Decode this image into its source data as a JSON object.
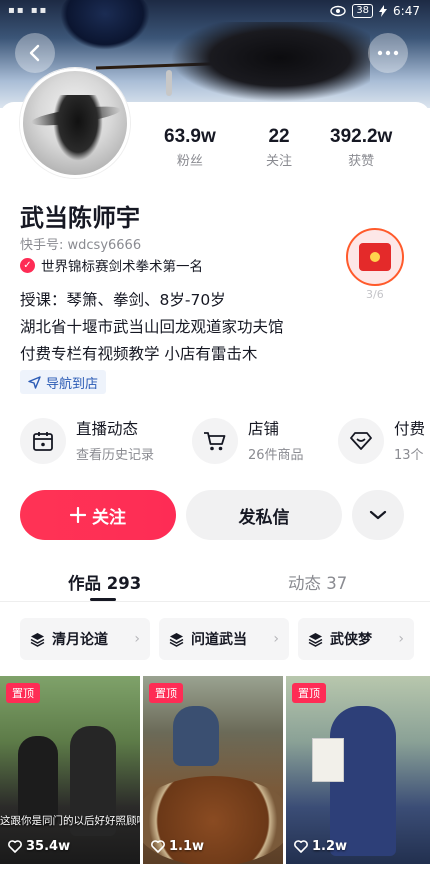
{
  "status_bar": {
    "left_icons": "▪▪ ▪▪",
    "battery": "38",
    "time": "6:47"
  },
  "profile": {
    "name": "武当陈师宇",
    "kuaishou_id": "快手号: wdcsy6666",
    "title_badge": "世界锦标赛剑术拳术第一名",
    "bio_lines": [
      "授课：琴箫、拳剑、8岁-70岁",
      "湖北省十堰市武当山回龙观道家功夫馆",
      "付费专栏有视频教学 小店有雷击木"
    ],
    "navigate_label": "导航到店",
    "gift_count": "3/6"
  },
  "stats": [
    {
      "value": "63.9w",
      "label": "粉丝"
    },
    {
      "value": "22",
      "label": "关注"
    },
    {
      "value": "392.2w",
      "label": "获赞"
    }
  ],
  "services": [
    {
      "title": "直播动态",
      "subtitle": "查看历史记录",
      "icon": "calendar-icon"
    },
    {
      "title": "店铺",
      "subtitle": "26件商品",
      "icon": "cart-icon"
    },
    {
      "title": "付费",
      "subtitle": "13个",
      "icon": "diamond-icon"
    }
  ],
  "actions": {
    "follow": "关注",
    "message": "发私信"
  },
  "tabs": {
    "works": "作品 293",
    "moments": "动态 37"
  },
  "collections": [
    {
      "label": "清月论道"
    },
    {
      "label": "问道武当"
    },
    {
      "label": "武侠梦"
    }
  ],
  "videos": [
    {
      "pin": "置顶",
      "likes": "35.4w",
      "caption": "这跟你是同门的以后好好照顾啊"
    },
    {
      "pin": "置顶",
      "likes": "1.1w",
      "caption": ""
    },
    {
      "pin": "置顶",
      "likes": "1.2w",
      "caption": ""
    }
  ],
  "colors": {
    "accent": "#fe2c55",
    "text": "#161823",
    "muted": "#8a8b91",
    "link": "#2b5bb5"
  }
}
